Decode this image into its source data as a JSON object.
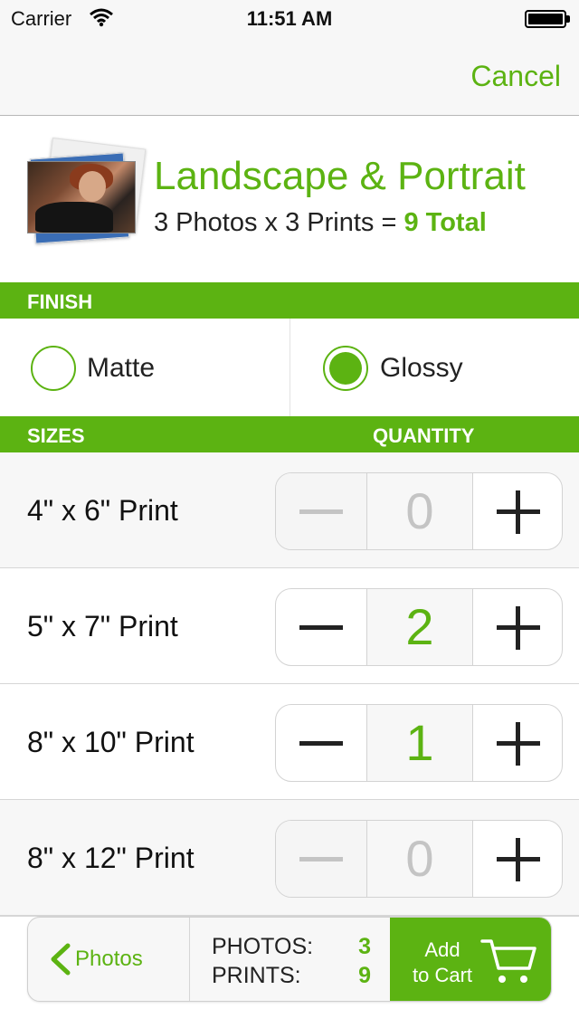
{
  "status": {
    "carrier": "Carrier",
    "time": "11:51 AM"
  },
  "nav": {
    "cancel_label": "Cancel"
  },
  "header": {
    "title": "Landscape & Portrait",
    "subtitle_prefix": "3 Photos x 3 Prints = ",
    "total_text": "9 Total"
  },
  "finish": {
    "section_label": "FINISH",
    "options": [
      {
        "label": "Matte",
        "selected": false
      },
      {
        "label": "Glossy",
        "selected": true
      }
    ]
  },
  "sizes": {
    "section_label": "SIZES",
    "quantity_label": "QUANTITY",
    "rows": [
      {
        "label": "4\" x 6\" Print",
        "quantity": "0"
      },
      {
        "label": "5\" x 7\" Print",
        "quantity": "2"
      },
      {
        "label": "8\" x 10\" Print",
        "quantity": "1"
      },
      {
        "label": "8\" x 12\" Print",
        "quantity": "0"
      }
    ]
  },
  "toolbar": {
    "back_label": "Photos",
    "photos_label": "PHOTOS:",
    "photos_count": "3",
    "prints_label": "PRINTS:",
    "prints_count": "9",
    "cart_label_line1": "Add",
    "cart_label_line2": "to Cart"
  },
  "colors": {
    "accent": "#5cb312",
    "disabled": "#c4c4c4"
  },
  "icons": [
    "wifi-icon",
    "battery-icon",
    "chevron-left-icon",
    "cart-icon",
    "minus-icon",
    "plus-icon"
  ]
}
